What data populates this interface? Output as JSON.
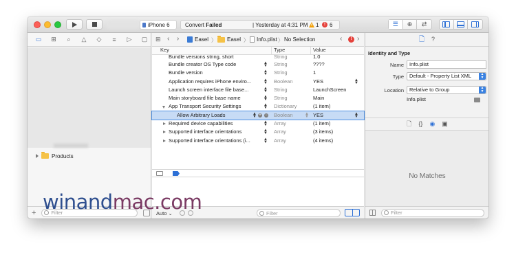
{
  "toolbar": {
    "scheme_device": "iPhone 6",
    "activity_status_prefix": "Convert",
    "activity_status_state": "Failed",
    "activity_time": "Yesterday at 4:31 PM",
    "warning_count": "1",
    "error_count": "6",
    "run_icon": "play-icon",
    "stop_icon": "stop-icon"
  },
  "navigator": {
    "tab_icons": [
      "folder-icon",
      "hierarchy-icon",
      "search-icon",
      "warning-icon",
      "test-icon",
      "debug-icon",
      "breakpoint-icon",
      "report-icon"
    ],
    "items": [
      {
        "label": "Products"
      }
    ],
    "filter_placeholder": "Filter"
  },
  "jumpbar": {
    "project": "Easel",
    "group": "Easel",
    "file": "Info.plist",
    "selection": "No Selection"
  },
  "plist": {
    "headers": {
      "key": "Key",
      "type": "Type",
      "value": "Value"
    },
    "rows": [
      {
        "key": "Bundle versions string, short",
        "type": "String",
        "value": "1.0"
      },
      {
        "key": "Bundle creator OS Type code",
        "type": "String",
        "value": "????"
      },
      {
        "key": "Bundle version",
        "type": "String",
        "value": "1"
      },
      {
        "key": "Application requires iPhone enviro...",
        "type": "Boolean",
        "value": "YES"
      },
      {
        "key": "Launch screen interface file base...",
        "type": "String",
        "value": "LaunchScreen"
      },
      {
        "key": "Main storyboard file base name",
        "type": "String",
        "value": "Main"
      },
      {
        "key": "App Transport Security Settings",
        "type": "Dictionary",
        "value": "(1 item)"
      },
      {
        "key": "Allow Arbitrary Loads",
        "type": "Boolean",
        "value": "YES"
      },
      {
        "key": "Required device capabilities",
        "type": "Array",
        "value": "(1 item)"
      },
      {
        "key": "Supported interface orientations",
        "type": "Array",
        "value": "(3 items)"
      },
      {
        "key": "Supported interface orientations (i...",
        "type": "Array",
        "value": "(4 items)"
      }
    ]
  },
  "editor_bottom": {
    "auto_label": "Auto",
    "filter_placeholder": "Filter"
  },
  "inspector": {
    "section_title": "Identity and Type",
    "name_label": "Name",
    "name_value": "Info.plist",
    "type_label": "Type",
    "type_value": "Default - Property List XML",
    "location_label": "Location",
    "location_value": "Relative to Group",
    "file_name": "Info.plist",
    "no_matches": "No Matches",
    "filter_placeholder": "Filter"
  },
  "watermark": {
    "part1": "winand",
    "part2": "mac.com"
  }
}
